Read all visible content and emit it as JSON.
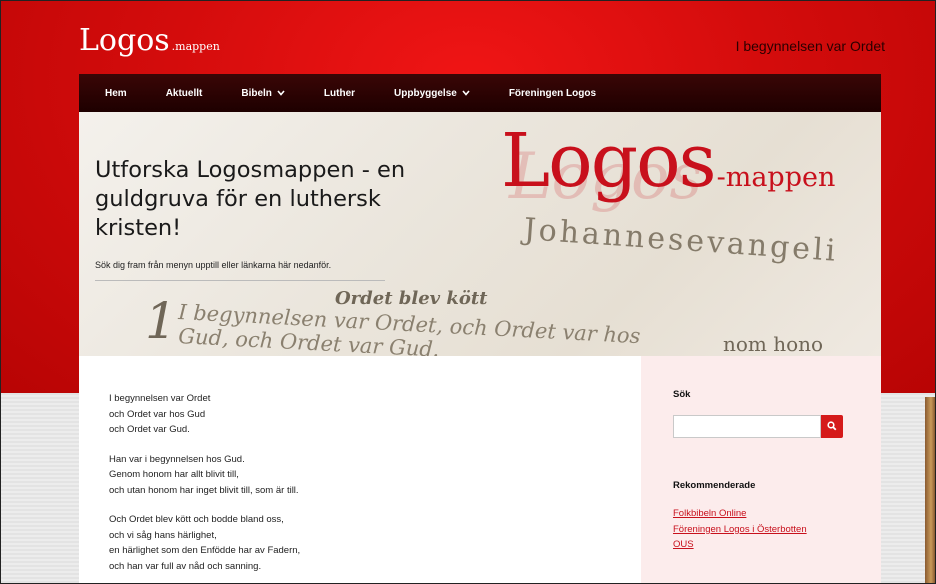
{
  "site": {
    "logo_main": "Logos",
    "logo_small": ".mappen",
    "tagline": "I begynnelsen var Ordet"
  },
  "nav": {
    "items": [
      {
        "label": "Hem",
        "dropdown": false
      },
      {
        "label": "Aktuellt",
        "dropdown": false
      },
      {
        "label": "Bibeln",
        "dropdown": true
      },
      {
        "label": "Luther",
        "dropdown": false
      },
      {
        "label": "Uppbyggelse",
        "dropdown": true
      },
      {
        "label": "Föreningen Logos",
        "dropdown": false
      }
    ]
  },
  "hero": {
    "title": "Utforska Logosmappen - en guldgruva för en luthersk kristen!",
    "description": "Sök dig fram från menyn upptill eller länkarna här nedanför.",
    "logo_main": "Logos",
    "logo_small": "-mappen",
    "bg_johannes": "Johannesevangeli",
    "bg_ordet": "Ordet blev kött",
    "bg_verse_number": "1",
    "bg_line1": "I begynnelsen var Ordet, och Ordet var hos",
    "bg_line2": "Gud, och Ordet var Gud.",
    "bg_nom": "nom hono"
  },
  "main": {
    "paragraphs": [
      [
        "I begynnelsen var Ordet",
        "och Ordet var hos Gud",
        "och Ordet var Gud."
      ],
      [
        "Han var i begynnelsen hos Gud.",
        "Genom honom har allt blivit till,",
        "och utan honom har inget blivit till, som är till."
      ],
      [
        "Och Ordet blev kött och bodde bland oss,",
        "och vi såg hans härlighet,",
        "en härlighet som den Enfödde har av Fadern,",
        "och han var full av nåd och sanning."
      ]
    ]
  },
  "sidebar": {
    "search_heading": "Sök",
    "search_value": "",
    "search_icon": "search-icon",
    "recommended_heading": "Rekommenderade",
    "links": [
      "Folkbibeln Online",
      "Föreningen Logos i Österbotten",
      "OUS"
    ]
  },
  "colors": {
    "accent": "#c8101c",
    "nav_bg": "#2a0202",
    "sidebar_bg": "#fcecec"
  }
}
